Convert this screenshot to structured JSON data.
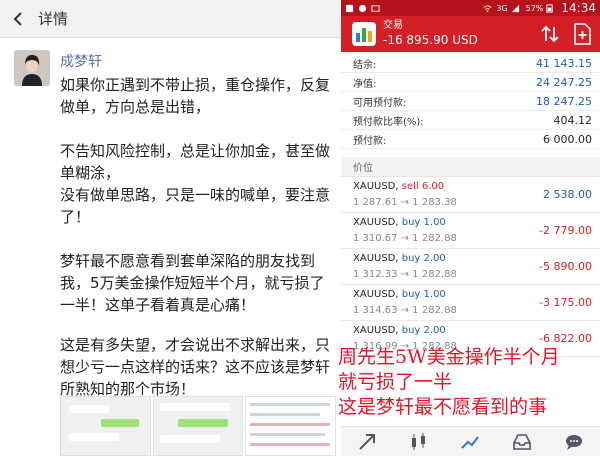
{
  "left": {
    "header": {
      "title": "详情"
    },
    "post": {
      "author": "成梦轩",
      "paragraphs": [
        "如果你正遇到不带止损，重仓操作，反复做单，方向总是出错，",
        "不告知风险控制，总是让你加金，甚至做单糊涂，",
        "没有做单思路，只是一味的喊单，要注意了！",
        "梦轩最不愿意看到套单深陷的朋友找到我，5万美金操作短短半个月，就亏损了一半！这单子看着真是心痛！",
        "这是有多失望，才会说出不求解出来，只想少亏一点这样的话来？这不应该是梦轩所熟知的那个市场！"
      ]
    }
  },
  "right": {
    "status": {
      "battery": "57%",
      "time": "14:34",
      "network": "3G"
    },
    "app": {
      "name": "交易",
      "balance": "-16 895.90 USD"
    },
    "summary": [
      {
        "label": "结余:",
        "value": "41 143.15"
      },
      {
        "label": "净值:",
        "value": "24 247.25"
      },
      {
        "label": "可用预付款:",
        "value": "18 247.25"
      },
      {
        "label": "预付款比率(%):",
        "value": "404.12"
      },
      {
        "label": "预付款:",
        "value": "6 000.00"
      }
    ],
    "price_header": "价位",
    "orders": [
      {
        "symbol": "XAUUSD,",
        "side": "sell 6.00",
        "open": "1 287.61",
        "arrow": "→",
        "current": "1 283.38",
        "pl": "2 538.00"
      },
      {
        "symbol": "XAUUSD,",
        "side": "buy 1.00",
        "open": "1 310.67",
        "arrow": "→",
        "current": "1 282.88",
        "pl": "-2 779.00"
      },
      {
        "symbol": "XAUUSD,",
        "side": "buy 2.00",
        "open": "1 312.33",
        "arrow": "→",
        "current": "1 282.88",
        "pl": "-5 890.00"
      },
      {
        "symbol": "XAUUSD,",
        "side": "buy 1.00",
        "open": "1 314.63",
        "arrow": "→",
        "current": "1 282.88",
        "pl": "-3 175.00"
      },
      {
        "symbol": "XAUUSD,",
        "side": "buy 2.00",
        "open": "1 316.99",
        "arrow": "→",
        "current": "1 282.88",
        "pl": "-6 822.00"
      }
    ]
  },
  "caption": [
    "周先生5W美金操作半个月",
    "就亏损了一半",
    "这是梦轩最不愿看到的事"
  ],
  "colors": {
    "app_red": "#d41f26",
    "blue_value": "#1e5fad",
    "caption_red": "#e3142a"
  },
  "icons": [
    "back-arrow-icon",
    "sort-icon",
    "add-document-icon",
    "quotes-icon",
    "chart-candles-icon",
    "trend-icon",
    "history-inbox-icon",
    "chat-icon"
  ]
}
